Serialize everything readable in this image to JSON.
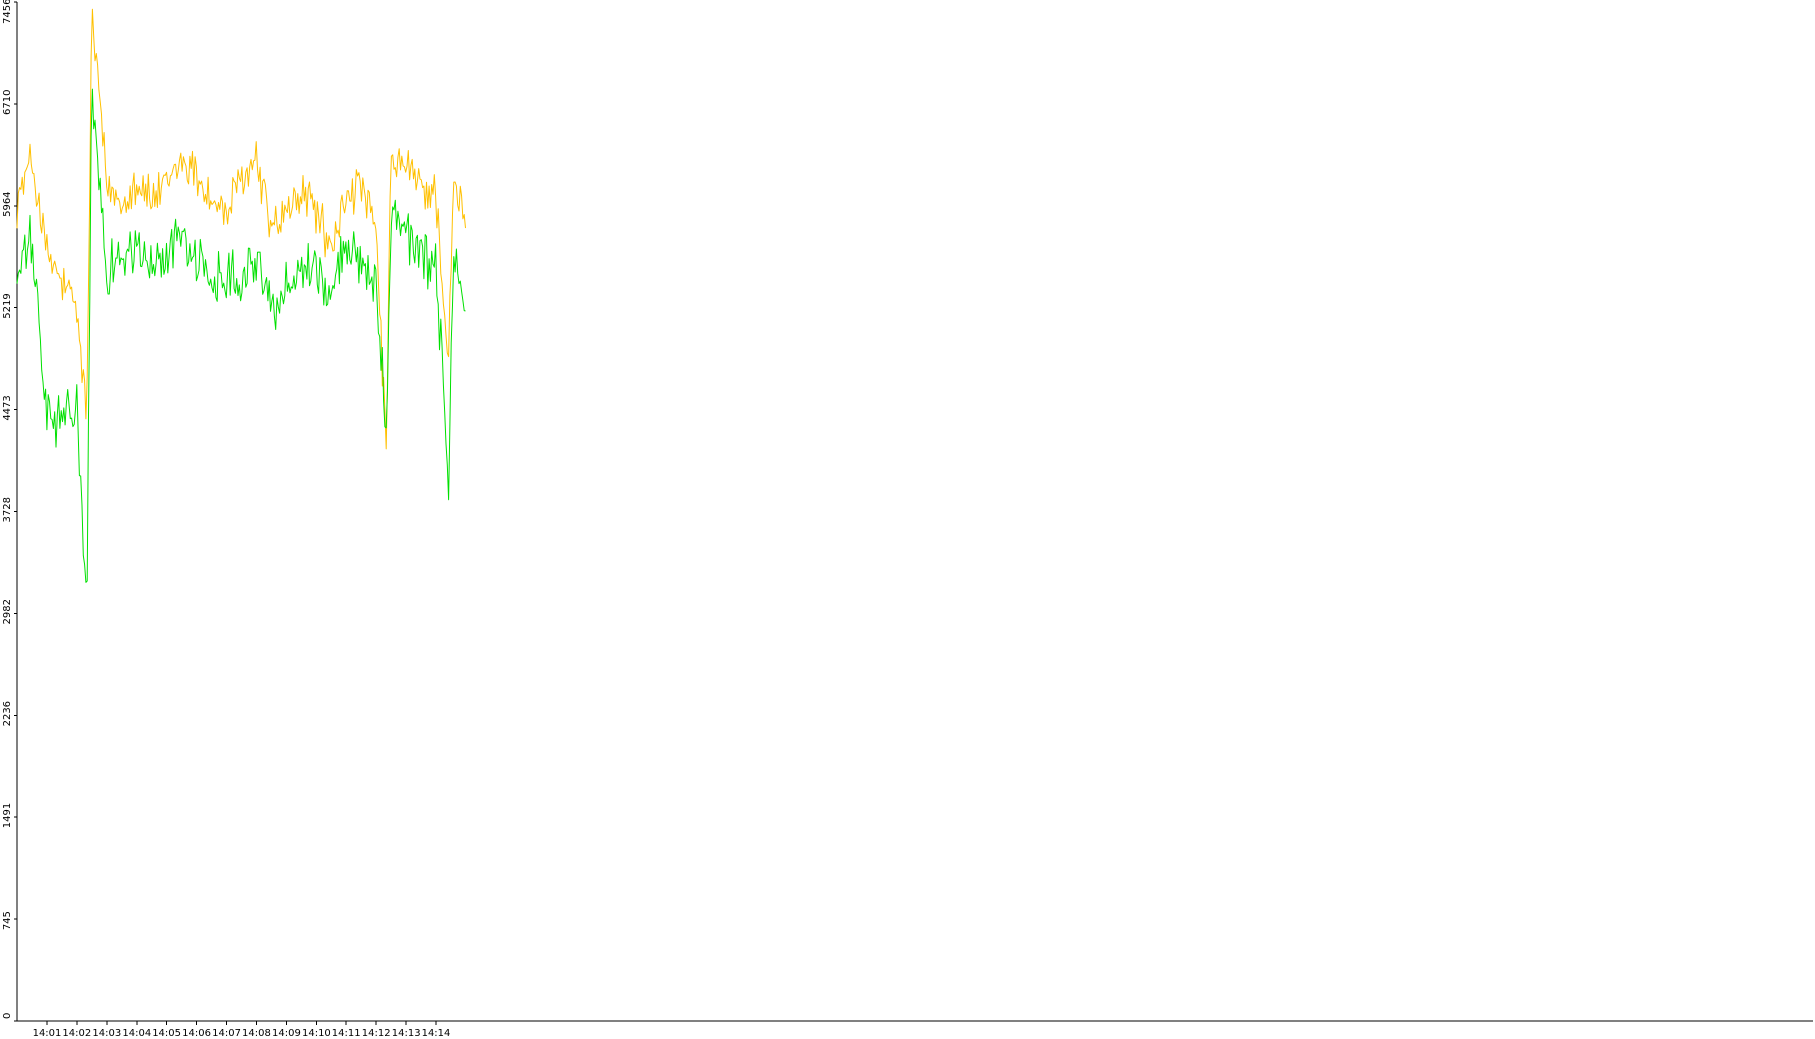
{
  "chart_data": {
    "type": "line",
    "title": "",
    "xlabel": "",
    "ylabel": "",
    "grid": false,
    "legend": "none",
    "x_domain_minutes": [
      14.0,
      15.0
    ],
    "ylim": [
      0,
      7456
    ],
    "y_ticks": [
      0,
      745,
      1491,
      2236,
      2982,
      3728,
      4473,
      5219,
      5964,
      6710,
      7456
    ],
    "x_ticks": [
      {
        "label": "14:01",
        "value": 14.0167
      },
      {
        "label": "14:02",
        "value": 14.0333
      },
      {
        "label": "14:03",
        "value": 14.05
      },
      {
        "label": "14:04",
        "value": 14.0667
      },
      {
        "label": "14:05",
        "value": 14.0833
      },
      {
        "label": "14:06",
        "value": 14.1
      },
      {
        "label": "14:07",
        "value": 14.1167
      },
      {
        "label": "14:08",
        "value": 14.1333
      },
      {
        "label": "14:09",
        "value": 14.15
      },
      {
        "label": "14:10",
        "value": 14.1667
      },
      {
        "label": "14:11",
        "value": 14.1833
      },
      {
        "label": "14:12",
        "value": 14.2
      },
      {
        "label": "14:13",
        "value": 14.2167
      },
      {
        "label": "14:14",
        "value": 14.2333
      }
    ],
    "series": [
      {
        "color": "#ffc000",
        "time": [
          "14:00",
          "14:00:30",
          "14:01",
          "14:01:30",
          "14:02",
          "14:02:20",
          "14:02:30",
          "14:03",
          "14:03:30",
          "14:04",
          "14:04:30",
          "14:05",
          "14:05:30",
          "14:06",
          "14:06:30",
          "14:07",
          "14:07:30",
          "14:08",
          "14:08:30",
          "14:09",
          "14:09:30",
          "14:10",
          "14:10:30",
          "14:11",
          "14:11:30",
          "14:12",
          "14:12:20",
          "14:12:30",
          "14:13",
          "14:13:30",
          "14:14",
          "14:14:25",
          "14:14:35",
          "14:15"
        ],
        "values": [
          6000,
          6300,
          5600,
          5400,
          5200,
          4400,
          7400,
          6100,
          6000,
          6150,
          6000,
          6100,
          6300,
          6200,
          6000,
          5900,
          6150,
          6300,
          5800,
          5900,
          6050,
          5950,
          5600,
          6050,
          6100,
          5750,
          4200,
          6300,
          6250,
          6100,
          6050,
          4800,
          6100,
          5850
        ]
      },
      {
        "color": "#00e000",
        "time": [
          "14:00",
          "14:00:30",
          "14:01",
          "14:01:30",
          "14:02",
          "14:02:20",
          "14:02:30",
          "14:03",
          "14:03:30",
          "14:04",
          "14:04:30",
          "14:05",
          "14:05:30",
          "14:06",
          "14:06:30",
          "14:07",
          "14:07:30",
          "14:08",
          "14:08:30",
          "14:09",
          "14:09:30",
          "14:10",
          "14:10:30",
          "14:11",
          "14:11:30",
          "14:12",
          "14:12:20",
          "14:12:30",
          "14:13",
          "14:13:30",
          "14:14",
          "14:14:25",
          "14:14:35",
          "14:15"
        ],
        "values": [
          5450,
          5700,
          4400,
          4400,
          4500,
          3000,
          6800,
          5500,
          5600,
          5650,
          5500,
          5600,
          5800,
          5550,
          5400,
          5500,
          5450,
          5600,
          5200,
          5350,
          5550,
          5500,
          5300,
          5650,
          5600,
          5400,
          4300,
          6000,
          5800,
          5600,
          5500,
          4000,
          5500,
          5300
        ]
      }
    ]
  }
}
